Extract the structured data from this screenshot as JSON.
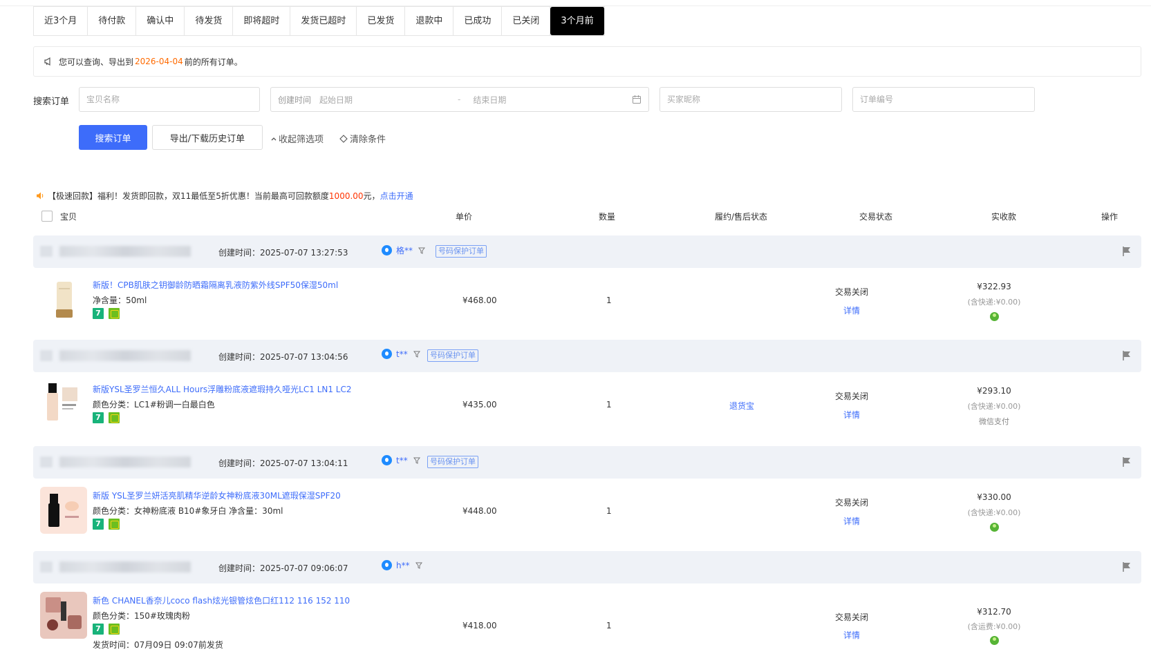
{
  "tabs": [
    "近3个月",
    "待付款",
    "确认中",
    "待发货",
    "即将超时",
    "发货已超时",
    "已发货",
    "退款中",
    "已成功",
    "已关闭",
    "3个月前"
  ],
  "active_tab": 10,
  "notice": {
    "prefix": "您可以查询、导出到",
    "date": "2026-04-04",
    "suffix": "前的所有订单。"
  },
  "search": {
    "label": "搜索订单",
    "product_placeholder": "宝贝名称",
    "date_label": "创建时间",
    "start_placeholder": "起始日期",
    "sep": "-",
    "end_placeholder": "结束日期",
    "buyer_placeholder": "买家昵称",
    "order_placeholder": "订单编号",
    "search_button": "搜索订单",
    "export_button": "导出/下载历史订单",
    "collapse_link": "收起筛选项",
    "clear_link": "清除条件"
  },
  "promo": {
    "text": "【极速回款】福利！发货即回款，双11最低至5折优惠！当前最高可回款额度",
    "amount": "1000.00",
    "unit": "元，",
    "link": "点击开通"
  },
  "table_header": {
    "item": "宝贝",
    "price": "单价",
    "qty": "数量",
    "fulfil": "履约/售后状态",
    "status": "交易状态",
    "paid": "实收款",
    "ops": "操作"
  },
  "orders": [
    {
      "created": "创建时间：2025-07-07 13:27:53",
      "buyer": "格**",
      "protect": "号码保护订单",
      "title": "新版！CPB肌肤之钥御龄防晒霜隔离乳液防紫外线SPF50保湿50ml",
      "spec": "净含量：50ml",
      "price": "¥468.00",
      "qty": "1",
      "fulfil": "",
      "status": "交易关闭",
      "detail": "详情",
      "paid": "¥322.93",
      "ship": "(含快递:¥0.00)",
      "pay": ""
    },
    {
      "created": "创建时间：2025-07-07 13:04:56",
      "buyer": "t**",
      "protect": "号码保护订单",
      "title": "新版YSL圣罗兰恒久ALL Hours浮雕粉底液遮瑕持久哑光LC1 LN1 LC2",
      "spec": "颜色分类：LC1#粉调一白最白色",
      "price": "¥435.00",
      "qty": "1",
      "fulfil": "退货宝",
      "status": "交易关闭",
      "detail": "详情",
      "paid": "¥293.10",
      "ship": "(含快递:¥0.00)",
      "pay": "微信支付"
    },
    {
      "created": "创建时间：2025-07-07 13:04:11",
      "buyer": "t**",
      "protect": "号码保护订单",
      "title": "新版 YSL圣罗兰妍活亮肌精华逆龄女神粉底液30ML遮瑕保湿SPF20",
      "spec": "颜色分类：女神粉底液 B10#象牙白  净含量：30ml",
      "price": "¥448.00",
      "qty": "1",
      "fulfil": "",
      "status": "交易关闭",
      "detail": "详情",
      "paid": "¥330.00",
      "ship": "(含快递:¥0.00)",
      "pay": ""
    },
    {
      "created": "创建时间：2025-07-07 09:06:07",
      "buyer": "h**",
      "protect": "",
      "title": "新色 CHANEL香奈儿coco flash炫光银管炫色口红112 116 152 110",
      "spec": "颜色分类：150#玫瑰肉粉",
      "price": "¥418.00",
      "qty": "1",
      "fulfil": "",
      "status": "交易关闭",
      "detail": "详情",
      "paid": "¥312.70",
      "ship": "(含运费:¥0.00)",
      "pay": "",
      "shiptime": "发货时间：07月09日 09:07前发货"
    }
  ]
}
